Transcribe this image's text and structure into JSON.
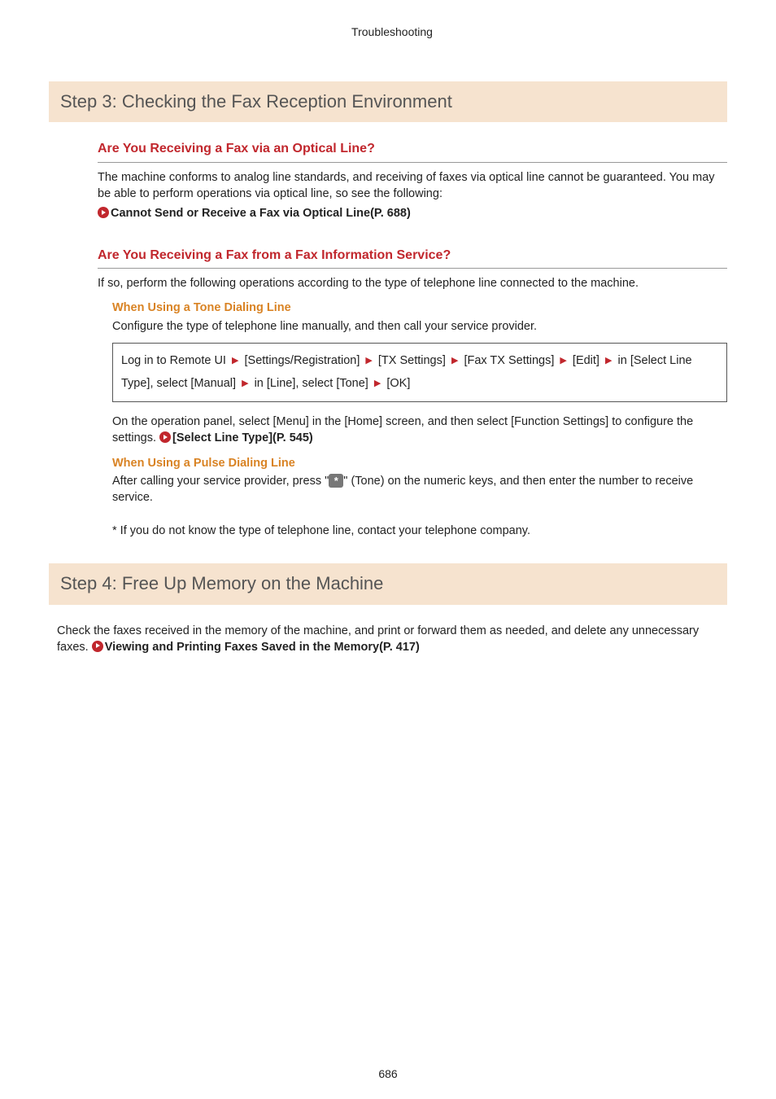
{
  "header": "Troubleshooting",
  "step3": {
    "title": "Step 3: Checking the Fax Reception Environment",
    "q1": {
      "heading": "Are You Receiving a Fax via an Optical Line?",
      "p1": "The machine conforms to analog line standards, and receiving of faxes via optical line cannot be guaranteed. You may be able to perform operations via optical line, so see the following:",
      "link": "Cannot Send or Receive a Fax via Optical Line(P. 688)"
    },
    "q2": {
      "heading": "Are You Receiving a Fax from a Fax Information Service?",
      "p1": "If so, perform the following operations according to the type of telephone line connected to the machine.",
      "tone": {
        "heading": "When Using a Tone Dialing Line",
        "p1": "Configure the type of telephone line manually, and then call your service provider.",
        "proc_parts": {
          "a": "Log in to Remote UI",
          "b": "[Settings/Registration]",
          "c": "[TX Settings]",
          "d": "[Fax TX Settings]",
          "e": "[Edit]",
          "f": "in [Select Line Type], select [Manual]",
          "g": "in [Line], select [Tone]",
          "h": "[OK]"
        },
        "p2a": "On the operation panel, select [Menu] in the [Home] screen, and then select [Function Settings] to configure the settings. ",
        "p2_link": "[Select Line Type](P. 545)"
      },
      "pulse": {
        "heading": "When Using a Pulse Dialing Line",
        "p1a": "After calling your service provider, press \"",
        "key": "*",
        "p1b": "\" (Tone) on the numeric keys, and then enter the number to receive service."
      },
      "note": "* If you do not know the type of telephone line, contact your telephone company."
    }
  },
  "step4": {
    "title": "Step 4: Free Up Memory on the Machine",
    "p1a": "Check the faxes received in the memory of the machine, and print or forward them as needed, and delete any unnecessary faxes. ",
    "link": "Viewing and Printing Faxes Saved in the Memory(P. 417)"
  },
  "page_number": "686"
}
